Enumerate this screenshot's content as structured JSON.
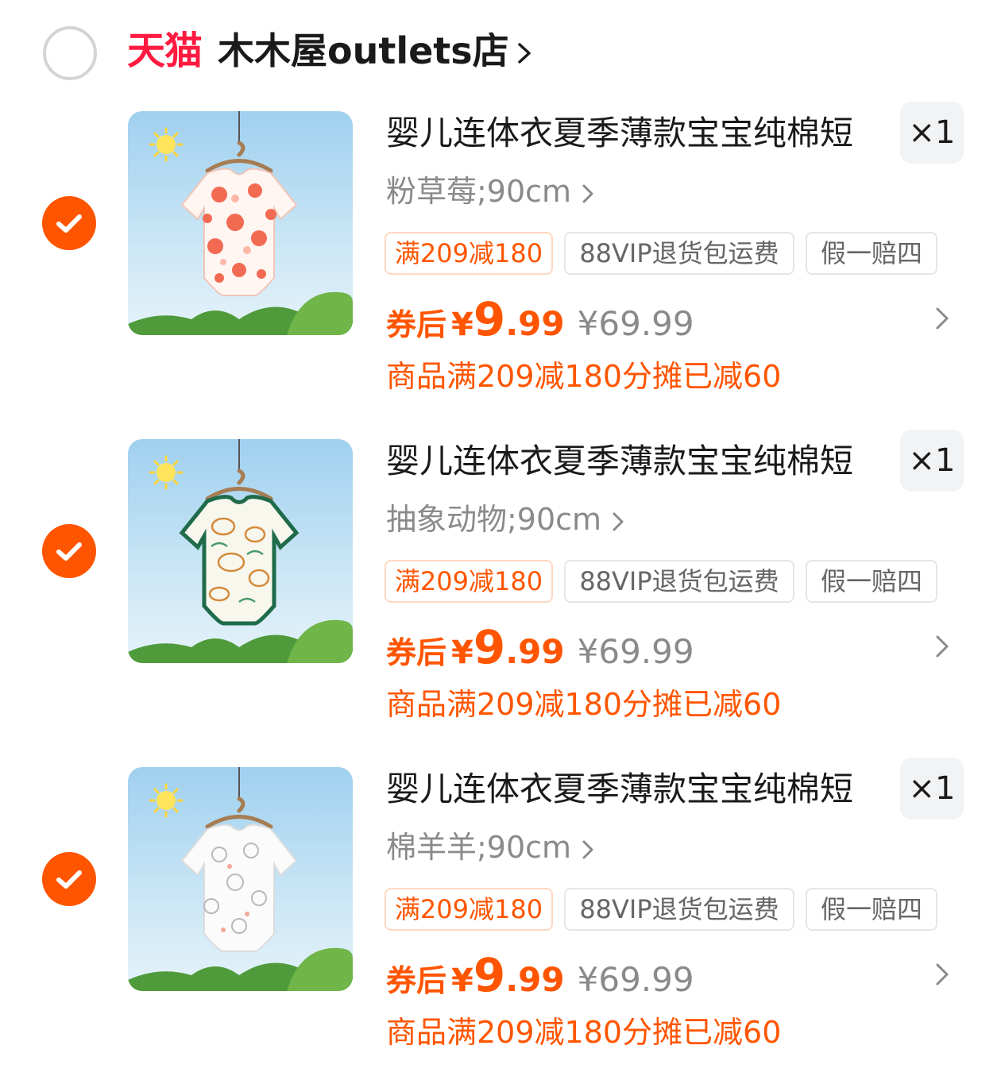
{
  "shop": {
    "platform_logo": "天猫",
    "name": "木木屋outlets店",
    "selected": false
  },
  "items": [
    {
      "title": "婴儿连体衣夏季薄款宝宝纯棉短",
      "sku": "粉草莓;90cm",
      "quantity": "×1",
      "tags": [
        "满209减180",
        "88VIP退货包运费",
        "假一赔四"
      ],
      "price_label": "券后",
      "price_yen": "¥",
      "price_int": "9",
      "price_dec": ".99",
      "original_price": "¥69.99",
      "promo_note": "商品满209减180分摊已减60",
      "selected": true,
      "image": "strawberry-print-onesie"
    },
    {
      "title": "婴儿连体衣夏季薄款宝宝纯棉短",
      "sku": "抽象动物;90cm",
      "quantity": "×1",
      "tags": [
        "满209减180",
        "88VIP退货包运费",
        "假一赔四"
      ],
      "price_label": "券后",
      "price_yen": "¥",
      "price_int": "9",
      "price_dec": ".99",
      "original_price": "¥69.99",
      "promo_note": "商品满209减180分摊已减60",
      "selected": true,
      "image": "animal-print-onesie"
    },
    {
      "title": "婴儿连体衣夏季薄款宝宝纯棉短",
      "sku": "棉羊羊;90cm",
      "quantity": "×1",
      "tags": [
        "满209减180",
        "88VIP退货包运费",
        "假一赔四"
      ],
      "price_label": "券后",
      "price_yen": "¥",
      "price_int": "9",
      "price_dec": ".99",
      "original_price": "¥69.99",
      "promo_note": "商品满209减180分摊已减60",
      "selected": true,
      "image": "sheep-print-onesie"
    }
  ],
  "colors": {
    "accent": "#ff5500",
    "tmall_red": "#ff1a40",
    "text_primary": "#1a1a1a",
    "text_secondary": "#8a8a8a"
  }
}
